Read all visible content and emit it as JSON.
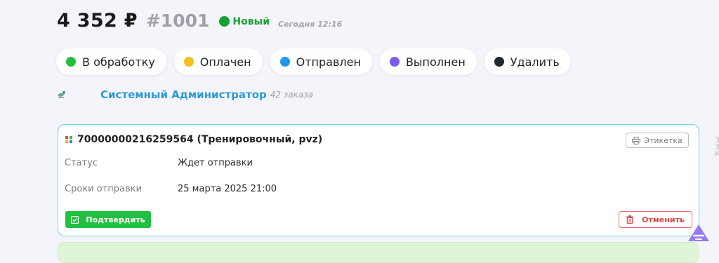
{
  "order": {
    "price": "4 352 ₽",
    "number": "#1001",
    "status": "Новый",
    "status_color": "#16a12f",
    "time": "Сегодня 12:16"
  },
  "actions": [
    {
      "label": "В обработку",
      "color": "#22c03c"
    },
    {
      "label": "Оплачен",
      "color": "#f5c01d"
    },
    {
      "label": "Отправлен",
      "color": "#2196f3"
    },
    {
      "label": "Выполнен",
      "color": "#7b5cf0"
    },
    {
      "label": "Удалить",
      "color": "#222831"
    }
  ],
  "customer": {
    "name": "Системный Администратор",
    "orders_count": "42 заказа"
  },
  "shipment": {
    "track": "70000000216259564 (Тренировочный, pvz)",
    "label_button": "Этикетка",
    "status_label": "Статус",
    "status_value": "Ждет отправки",
    "deadline_label": "Сроки отправки",
    "deadline_value": "25 марта 2025 21:00",
    "confirm_button": "Подтвердить",
    "cancel_button": "Отменить"
  },
  "right_edge": {
    "line1": "З",
    "line2": "З",
    "line3": "К"
  }
}
